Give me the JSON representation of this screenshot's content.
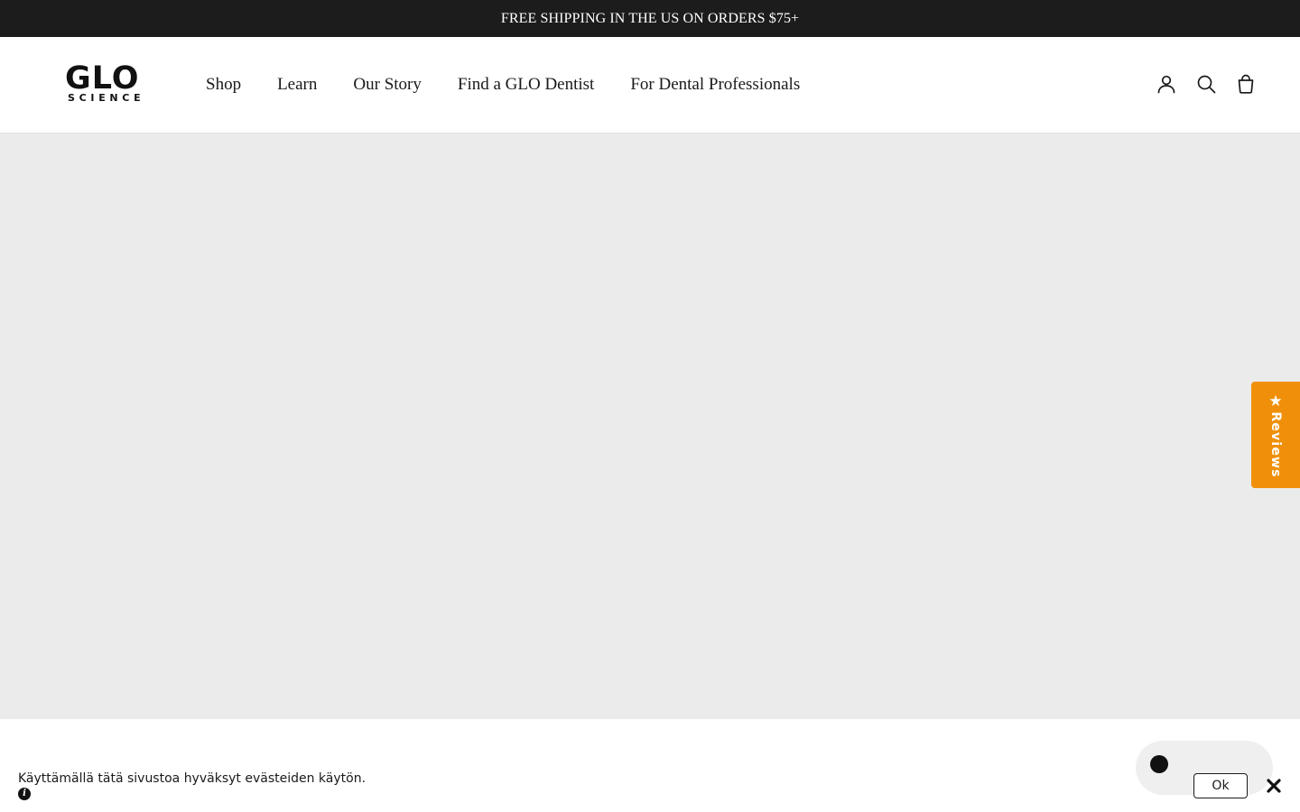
{
  "announcement": {
    "text": "FREE SHIPPING IN THE US ON ORDERS $75+"
  },
  "header": {
    "logo": {
      "main": "GLO",
      "sub": "SCIENCE"
    },
    "nav": [
      {
        "label": "Shop"
      },
      {
        "label": "Learn"
      },
      {
        "label": "Our Story"
      },
      {
        "label": "Find a GLO Dentist"
      },
      {
        "label": "For Dental Professionals"
      }
    ],
    "icons": [
      "account-icon",
      "search-icon",
      "cart-icon"
    ]
  },
  "reviews_tab": {
    "icon": "star-icon",
    "label": "Reviews",
    "color": "#f0900a"
  },
  "cookie_banner": {
    "text": "Käyttämällä tätä sivustoa hyväksyt evästeiden käytön.",
    "info_icon": "info-icon",
    "ok_label": "Ok",
    "close_icon": "close-icon"
  },
  "colors": {
    "announcement_bg": "#1c1c1c",
    "hero_bg": "#ebebeb",
    "accent": "#f0900a"
  }
}
